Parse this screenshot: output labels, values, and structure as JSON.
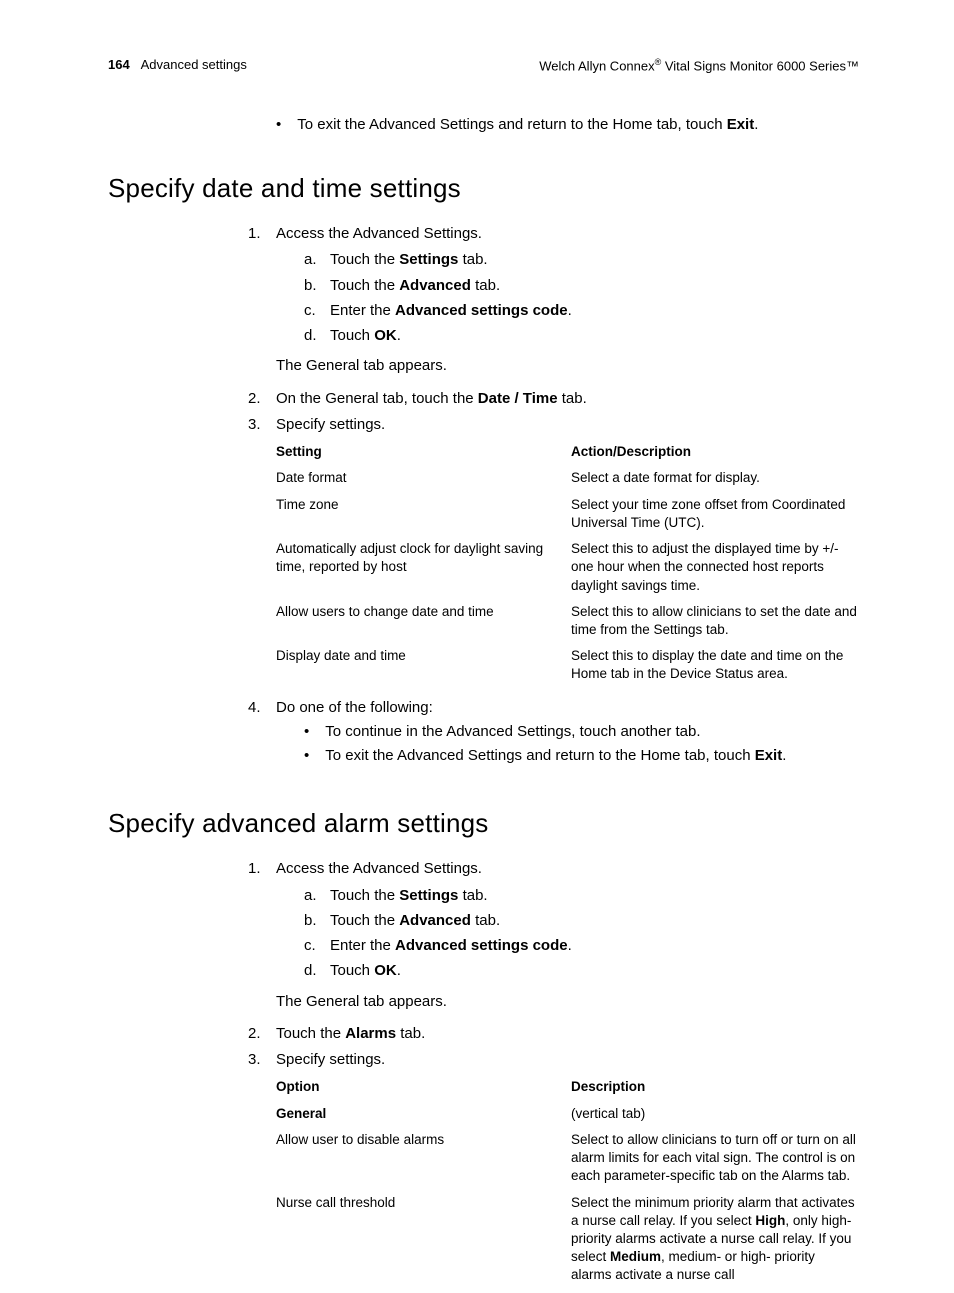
{
  "header": {
    "page_number": "164",
    "section": "Advanced settings",
    "right_prefix": "Welch Allyn Connex",
    "right_suffix": " Vital Signs Monitor 6000 Series™"
  },
  "top_bullet": {
    "pre": "To exit the Advanced Settings and return to the Home tab, touch ",
    "bold": "Exit",
    "post": "."
  },
  "section1": {
    "title": "Specify date and time settings",
    "step1": {
      "num": "1.",
      "text": "Access the Advanced Settings.",
      "a": {
        "let": "a.",
        "pre": "Touch the ",
        "bold": "Settings",
        "post": " tab."
      },
      "b": {
        "let": "b.",
        "pre": "Touch the ",
        "bold": "Advanced",
        "post": " tab."
      },
      "c": {
        "let": "c.",
        "pre": "Enter the ",
        "bold": "Advanced settings code",
        "post": "."
      },
      "d": {
        "let": "d.",
        "pre": "Touch ",
        "bold": "OK",
        "post": "."
      },
      "note": "The General tab appears."
    },
    "step2": {
      "num": "2.",
      "pre": "On the General tab, touch the ",
      "bold": "Date / Time",
      "post": " tab."
    },
    "step3": {
      "num": "3.",
      "text": "Specify settings.",
      "table": {
        "h1": "Setting",
        "h2": "Action/Description",
        "rows": [
          {
            "c1": "Date format",
            "c2": "Select a date format for display."
          },
          {
            "c1": "Time zone",
            "c2": "Select your time zone offset from Coordinated Universal Time (UTC)."
          },
          {
            "c1": "Automatically adjust clock for daylight saving time, reported by host",
            "c2": "Select this to adjust the displayed time by +/- one hour when the connected host reports daylight savings time."
          },
          {
            "c1": "Allow users to change date and time",
            "c2": "Select this to allow clinicians to set the date and time from the Settings tab."
          },
          {
            "c1": "Display date and time",
            "c2": "Select this to display the date and time on the Home tab in the Device Status area."
          }
        ]
      }
    },
    "step4": {
      "num": "4.",
      "text": "Do one of the following:",
      "b1": "To continue in the Advanced Settings, touch another tab.",
      "b2": {
        "pre": "To exit the Advanced Settings and return to the Home tab, touch ",
        "bold": "Exit",
        "post": "."
      }
    }
  },
  "section2": {
    "title": "Specify advanced alarm settings",
    "step1": {
      "num": "1.",
      "text": "Access the Advanced Settings.",
      "a": {
        "let": "a.",
        "pre": "Touch the ",
        "bold": "Settings",
        "post": " tab."
      },
      "b": {
        "let": "b.",
        "pre": "Touch the ",
        "bold": "Advanced",
        "post": " tab."
      },
      "c": {
        "let": "c.",
        "pre": "Enter the ",
        "bold": "Advanced settings code",
        "post": "."
      },
      "d": {
        "let": "d.",
        "pre": "Touch ",
        "bold": "OK",
        "post": "."
      },
      "note": "The General tab appears."
    },
    "step2": {
      "num": "2.",
      "pre": "Touch the ",
      "bold": "Alarms",
      "post": " tab."
    },
    "step3": {
      "num": "3.",
      "text": "Specify settings.",
      "table": {
        "h1": "Option",
        "h2": "Description",
        "general_label": "General",
        "general_desc": "(vertical tab)",
        "row1": {
          "c1": "Allow user to disable alarms",
          "c2": "Select to allow clinicians to turn off or turn on all alarm limits for each vital sign. The control is on each parameter-specific tab on the Alarms tab."
        },
        "row2": {
          "c1": "Nurse call threshold",
          "seg1": "Select the minimum priority alarm that activates a nurse call relay. If you select ",
          "b1": "High",
          "seg2": ", only high-priority alarms activate a nurse call relay. If you select ",
          "b2": "Medium",
          "seg3": ", medium- or high- priority alarms activate a nurse call"
        }
      }
    }
  }
}
